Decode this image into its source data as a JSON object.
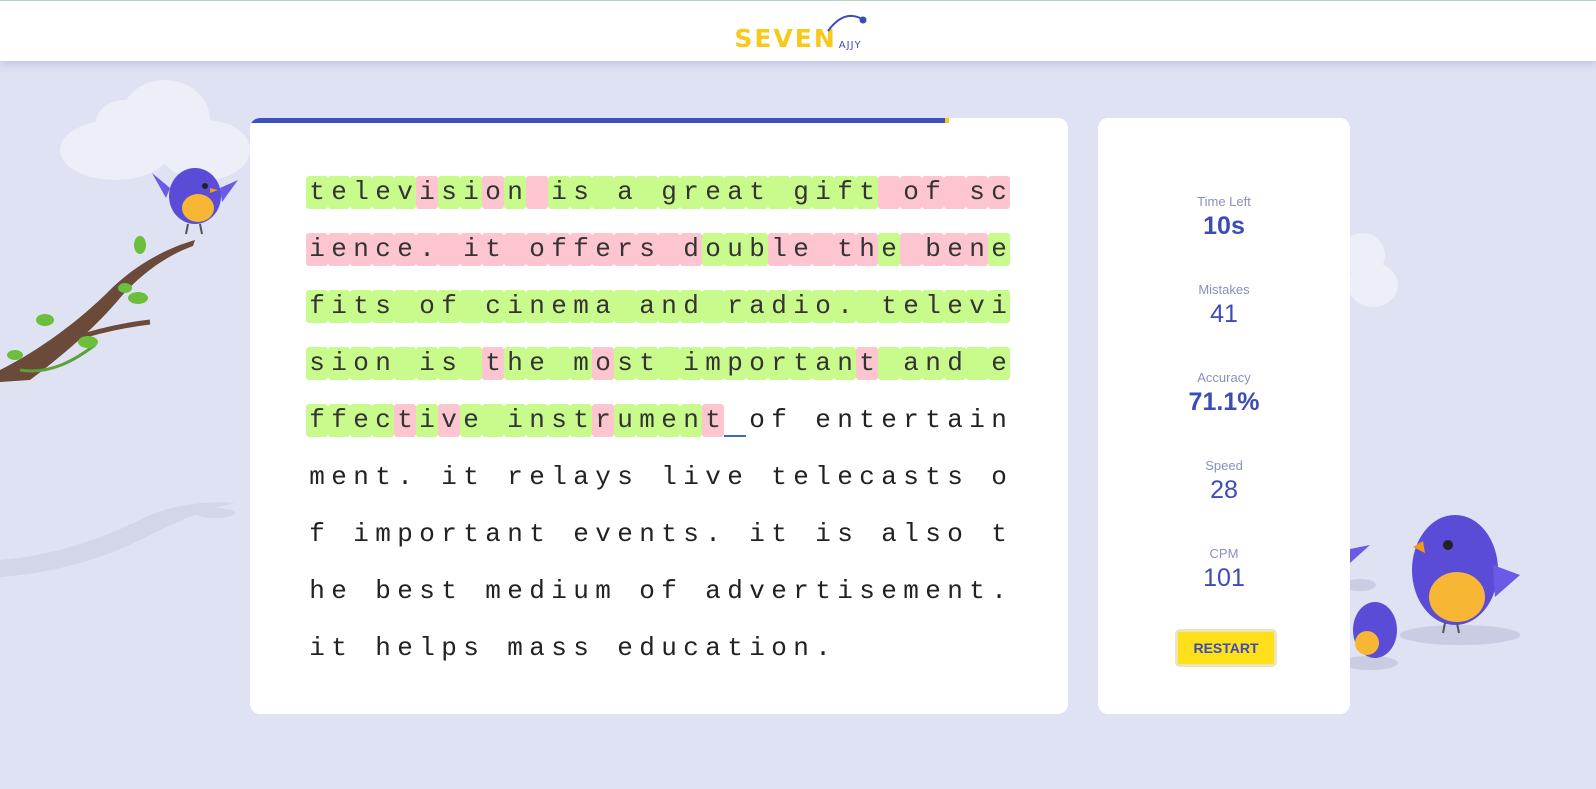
{
  "header": {
    "logo_main": "SEVEN",
    "logo_sub": "AJJY"
  },
  "progress": {
    "fraction": 0.85
  },
  "typing": {
    "lines": [
      "television is a great gift of sc",
      "ience. it offers double the bene",
      "fits of cinema and radio. televi",
      "sion is the most important and e",
      "ffective instrument of entertain",
      "ment. it relays live telecasts o",
      "f important events. it is also t",
      "he best medium of advertisement.",
      "it helps mass education."
    ],
    "status": [
      "gggggbggbgbgggggggggggggggbbbbbb",
      "bbbbbbbbbbbbbbbbbbgggbbbbbgbbbbg",
      "gggggggggggggggggggggggggggggggg",
      "ggggggggbggggbgggggggggggbggggggg",
      "ggggbgbggggggbggggb"
    ],
    "cursor": {
      "line": 4,
      "col": 19
    }
  },
  "stats": {
    "time_left_label": "Time Left",
    "time_left_value": "10s",
    "mistakes_label": "Mistakes",
    "mistakes_value": "41",
    "accuracy_label": "Accuracy",
    "accuracy_value": "71.1%",
    "speed_label": "Speed",
    "speed_value": "28",
    "cpm_label": "CPM",
    "cpm_value": "101",
    "restart_label": "RESTART"
  },
  "colors": {
    "correct_bg": "#c8fa8c",
    "wrong_bg": "#fcc5cf",
    "accent": "#3d4bb8",
    "brand_yellow": "#f9c91a"
  }
}
